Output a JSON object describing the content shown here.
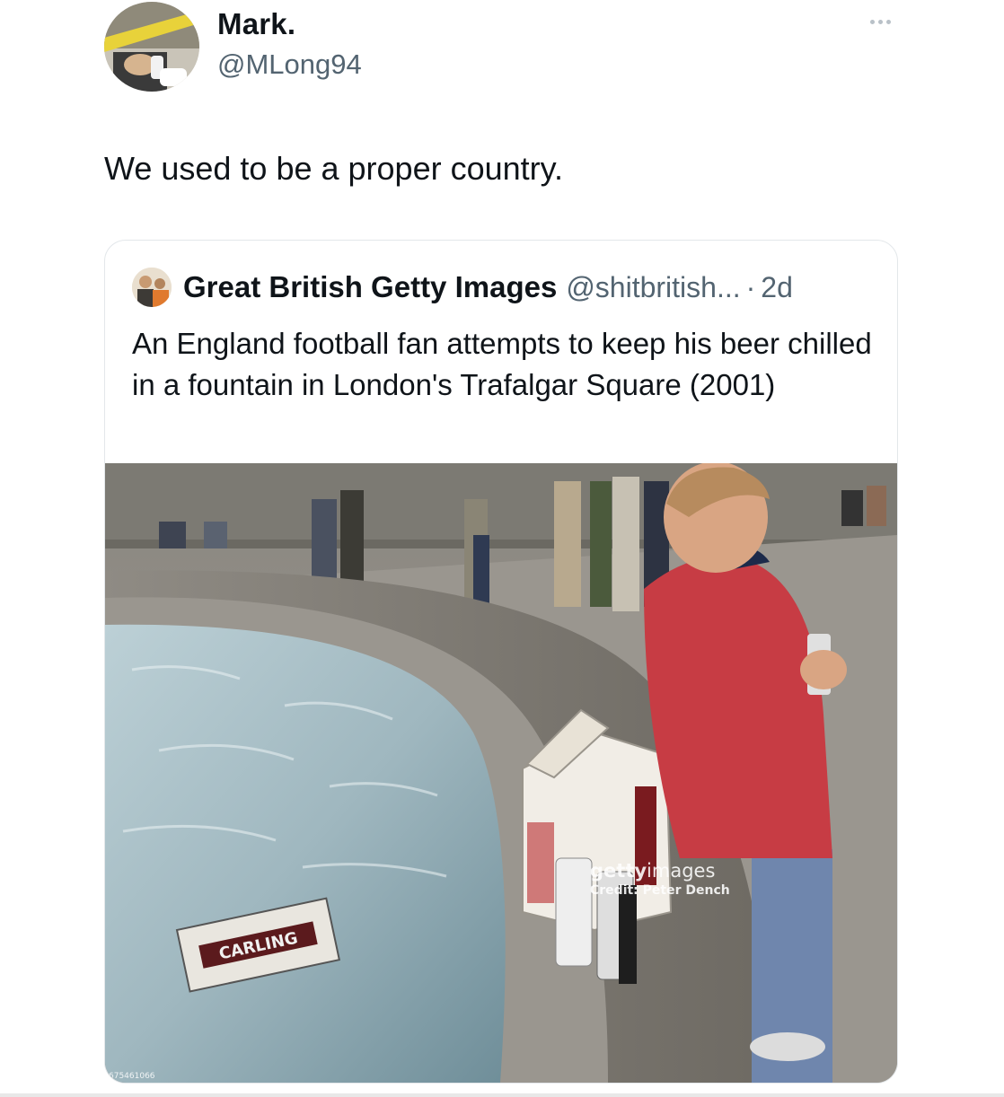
{
  "tweet": {
    "author": {
      "display_name": "Mark.",
      "handle": "@MLong94"
    },
    "text": "We used to be a proper country.",
    "more_icon": "more-horizontal-icon"
  },
  "quoted_tweet": {
    "author": {
      "display_name": "Great British Getty Images",
      "handle": "@shitbritish...",
      "separator": "·",
      "time": "2d"
    },
    "text": "An England football fan attempts to keep his beer chilled in a fountain in London's Trafalgar Square (2001)",
    "photo": {
      "watermark_logo_bold": "getty",
      "watermark_logo_light": "images",
      "watermark_credit": "Credit: Peter Dench",
      "image_id": "675461066",
      "box_label": "CARLING"
    }
  }
}
